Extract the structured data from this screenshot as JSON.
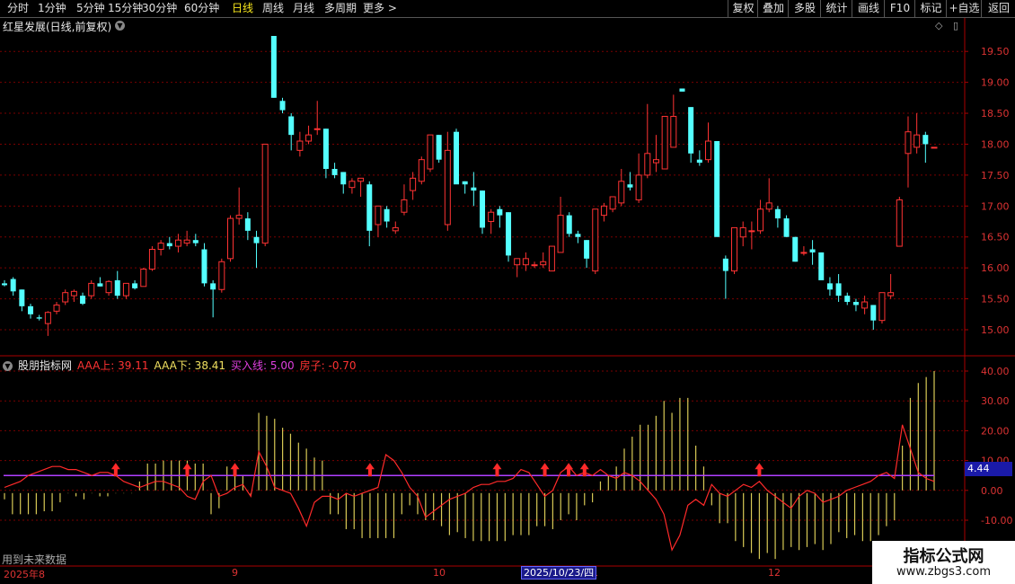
{
  "toolbar": {
    "periods": [
      "分时",
      "1分钟",
      "5分钟",
      "15分钟",
      "30分钟",
      "60分钟",
      "日线",
      "周线",
      "月线",
      "多周期",
      "更多 >"
    ],
    "active": "日线",
    "right_buttons": [
      "复权",
      "叠加",
      "多股",
      "统计",
      "画线",
      "F10",
      "标记",
      "+自选",
      "返回"
    ]
  },
  "stock": {
    "title": "红星发展(日线,前复权)"
  },
  "indicator": {
    "name": "股朋指标网",
    "lines": [
      {
        "label": "AAA上: 39.11",
        "color": "#ff3333"
      },
      {
        "label": "AAA下: 38.41",
        "color": "#f0e060"
      },
      {
        "label": "买入线: 5.00",
        "color": "#e040e0"
      },
      {
        "label": "房子: -0.70",
        "color": "#ff3333"
      }
    ],
    "value_badge": "4.44",
    "future_note": "用到未来数据"
  },
  "price_axis": [
    "19.50",
    "19.00",
    "18.50",
    "18.00",
    "17.50",
    "17.00",
    "16.50",
    "16.00",
    "15.50",
    "15.00"
  ],
  "ind_axis": [
    "40.00",
    "30.00",
    "20.00",
    "10.00",
    "0.00",
    "-10.00"
  ],
  "date_axis": {
    "labels": [
      {
        "text": "2025年8"
      },
      {
        "text": "9"
      },
      {
        "text": "10"
      },
      {
        "text": "1"
      },
      {
        "text": "12"
      }
    ],
    "cursor": "2025/10/23/四"
  },
  "watermark": {
    "line1": "指标公式网",
    "line2": "www.zbgs3.com"
  },
  "colors": {
    "up": "#ff3333",
    "down": "#54ffff",
    "grid": "#7a0000",
    "buyline": "#b040ff"
  },
  "chart_data": {
    "type": "candlestick",
    "price_ylim": [
      14.8,
      19.9
    ],
    "ind_ylim": [
      -15,
      42
    ],
    "candles": [
      [
        15.75,
        15.8,
        15.7,
        15.72
      ],
      [
        15.82,
        15.85,
        15.55,
        15.62
      ],
      [
        15.65,
        15.65,
        15.3,
        15.38
      ],
      [
        15.38,
        15.42,
        15.18,
        15.25
      ],
      [
        15.2,
        15.24,
        15.15,
        15.18
      ],
      [
        15.1,
        15.3,
        14.9,
        15.28
      ],
      [
        15.3,
        15.45,
        15.25,
        15.4
      ],
      [
        15.45,
        15.65,
        15.4,
        15.6
      ],
      [
        15.55,
        15.65,
        15.45,
        15.62
      ],
      [
        15.55,
        15.6,
        15.4,
        15.42
      ],
      [
        15.55,
        15.8,
        15.5,
        15.75
      ],
      [
        15.75,
        15.85,
        15.7,
        15.7
      ],
      [
        15.6,
        15.8,
        15.55,
        15.78
      ],
      [
        15.8,
        15.95,
        15.5,
        15.55
      ],
      [
        15.55,
        15.75,
        15.5,
        15.75
      ],
      [
        15.75,
        15.8,
        15.65,
        15.67
      ],
      [
        15.7,
        16.0,
        15.7,
        15.98
      ],
      [
        15.98,
        16.35,
        15.95,
        16.3
      ],
      [
        16.3,
        16.45,
        16.2,
        16.4
      ],
      [
        16.4,
        16.5,
        16.3,
        16.35
      ],
      [
        16.35,
        16.55,
        16.25,
        16.45
      ],
      [
        16.4,
        16.6,
        16.35,
        16.45
      ],
      [
        16.45,
        16.55,
        16.35,
        16.4
      ],
      [
        16.3,
        16.4,
        15.7,
        15.75
      ],
      [
        15.75,
        15.8,
        15.2,
        15.65
      ],
      [
        15.65,
        16.15,
        15.6,
        16.1
      ],
      [
        16.15,
        16.85,
        16.1,
        16.8
      ],
      [
        16.8,
        17.3,
        16.7,
        16.85
      ],
      [
        16.8,
        16.9,
        16.45,
        16.6
      ],
      [
        16.5,
        16.6,
        16.0,
        16.4
      ],
      [
        16.4,
        18.0,
        16.35,
        18.0
      ],
      [
        19.75,
        19.75,
        18.75,
        18.75
      ],
      [
        18.7,
        18.75,
        18.5,
        18.55
      ],
      [
        18.45,
        18.5,
        17.9,
        18.15
      ],
      [
        17.9,
        18.2,
        17.8,
        18.05
      ],
      [
        18.05,
        18.3,
        18.0,
        18.15
      ],
      [
        18.25,
        18.7,
        18.15,
        18.25
      ],
      [
        18.25,
        18.25,
        17.45,
        17.6
      ],
      [
        17.6,
        17.7,
        17.45,
        17.5
      ],
      [
        17.55,
        17.55,
        17.2,
        17.35
      ],
      [
        17.3,
        17.45,
        17.2,
        17.4
      ],
      [
        17.4,
        17.4,
        17.15,
        17.45
      ],
      [
        17.35,
        17.4,
        16.35,
        16.6
      ],
      [
        16.7,
        17.0,
        16.5,
        17.0
      ],
      [
        16.95,
        17.0,
        16.65,
        16.75
      ],
      [
        16.6,
        16.75,
        16.55,
        16.65
      ],
      [
        16.9,
        17.35,
        16.85,
        17.1
      ],
      [
        17.25,
        17.55,
        17.1,
        17.45
      ],
      [
        17.4,
        17.8,
        17.35,
        17.75
      ],
      [
        17.6,
        18.15,
        17.55,
        18.15
      ],
      [
        18.15,
        18.15,
        17.7,
        17.75
      ],
      [
        16.7,
        18.2,
        16.6,
        17.9
      ],
      [
        18.2,
        18.25,
        17.45,
        17.35
      ],
      [
        17.4,
        17.4,
        17.2,
        17.35
      ],
      [
        17.3,
        17.55,
        17.0,
        17.25
      ],
      [
        17.25,
        17.25,
        16.55,
        16.65
      ],
      [
        16.75,
        16.95,
        16.55,
        16.9
      ],
      [
        16.95,
        17.0,
        16.65,
        16.85
      ],
      [
        16.9,
        16.9,
        16.1,
        16.2
      ],
      [
        16.05,
        16.15,
        15.85,
        16.15
      ],
      [
        16.05,
        16.25,
        15.95,
        16.15
      ],
      [
        16.05,
        16.1,
        16.0,
        16.05
      ],
      [
        16.05,
        16.25,
        16.0,
        16.1
      ],
      [
        15.95,
        16.35,
        15.95,
        16.35
      ],
      [
        16.25,
        17.15,
        16.25,
        16.85
      ],
      [
        16.85,
        16.9,
        16.5,
        16.55
      ],
      [
        16.55,
        16.6,
        16.4,
        16.5
      ],
      [
        16.45,
        16.45,
        16.0,
        16.15
      ],
      [
        15.95,
        16.95,
        15.9,
        16.95
      ],
      [
        16.85,
        17.05,
        16.75,
        17.0
      ],
      [
        16.95,
        17.15,
        16.9,
        17.15
      ],
      [
        17.05,
        17.6,
        17.0,
        17.4
      ],
      [
        17.35,
        17.55,
        17.25,
        17.3
      ],
      [
        17.1,
        17.85,
        17.05,
        17.5
      ],
      [
        17.5,
        18.65,
        17.45,
        17.85
      ],
      [
        17.7,
        18.15,
        17.55,
        17.75
      ],
      [
        17.6,
        18.35,
        17.6,
        18.45
      ],
      [
        17.95,
        18.8,
        17.95,
        18.45
      ],
      [
        18.9,
        18.9,
        18.85,
        18.85
      ],
      [
        18.6,
        18.6,
        17.7,
        17.85
      ],
      [
        17.75,
        17.9,
        17.65,
        17.7
      ],
      [
        17.75,
        18.35,
        17.7,
        18.05
      ],
      [
        18.05,
        18.05,
        16.5,
        16.5
      ],
      [
        16.15,
        16.2,
        15.5,
        15.95
      ],
      [
        15.95,
        16.5,
        15.9,
        16.65
      ],
      [
        16.5,
        16.75,
        16.35,
        16.65
      ],
      [
        16.6,
        16.75,
        16.3,
        16.6
      ],
      [
        16.6,
        17.1,
        16.55,
        16.95
      ],
      [
        16.95,
        17.45,
        16.9,
        17.05
      ],
      [
        16.95,
        17.0,
        16.65,
        16.8
      ],
      [
        16.8,
        16.85,
        16.5,
        16.5
      ],
      [
        16.5,
        16.5,
        16.1,
        16.1
      ],
      [
        16.25,
        16.35,
        16.2,
        16.25
      ],
      [
        16.3,
        16.45,
        16.05,
        16.25
      ],
      [
        16.25,
        16.25,
        15.9,
        15.8
      ],
      [
        15.75,
        15.85,
        15.55,
        15.65
      ],
      [
        15.75,
        15.9,
        15.45,
        15.55
      ],
      [
        15.55,
        15.6,
        15.4,
        15.45
      ],
      [
        15.45,
        15.5,
        15.3,
        15.4
      ],
      [
        15.35,
        15.55,
        15.25,
        15.45
      ],
      [
        15.4,
        15.4,
        15.0,
        15.15
      ],
      [
        15.15,
        15.6,
        15.1,
        15.6
      ],
      [
        15.55,
        15.9,
        15.5,
        15.6
      ],
      [
        16.35,
        17.15,
        16.35,
        17.1
      ],
      [
        17.85,
        18.45,
        17.3,
        18.2
      ],
      [
        17.95,
        18.5,
        17.85,
        18.15
      ],
      [
        18.15,
        18.2,
        17.7,
        18.0
      ],
      [
        17.95,
        17.95,
        17.95,
        17.95
      ]
    ],
    "bars": [
      -3,
      -8,
      -8,
      -8,
      -8,
      -7,
      -7,
      -4,
      -1,
      -2,
      -3,
      -1,
      -2,
      -2,
      -1,
      -1,
      -1,
      3,
      9,
      9,
      10,
      10,
      10,
      10,
      9,
      9,
      -8,
      -6,
      8,
      8,
      5,
      -2,
      26,
      25,
      24,
      21,
      19,
      16,
      14,
      11,
      10,
      -8,
      -8,
      -13,
      -13,
      -16,
      -16,
      -16,
      -16,
      -16,
      -8,
      -5,
      -8,
      -10,
      -10,
      -12,
      -15,
      -14,
      -16,
      -17,
      -17,
      -17,
      -17,
      -17,
      -15,
      -15,
      -15,
      -12,
      -12,
      -13,
      -10,
      -8,
      -10,
      -5,
      -4,
      3,
      5,
      8,
      14,
      18,
      22,
      22,
      25,
      30,
      26,
      31,
      31,
      15,
      8,
      -5,
      -11,
      -11,
      -17,
      -19,
      -21,
      -23,
      -21,
      -23,
      -20,
      -19,
      -20,
      -19,
      -18,
      -20,
      -18,
      -14,
      -16,
      -15,
      -17,
      -17,
      -15,
      -12,
      -10,
      15,
      31,
      36,
      38,
      40
    ],
    "red_line": [
      1,
      2,
      3,
      5,
      6,
      7,
      8,
      8,
      7,
      7,
      6,
      5,
      6,
      6,
      5,
      3,
      2,
      1,
      2,
      3,
      3,
      2,
      1,
      -2,
      -3,
      3,
      5,
      -2,
      -1,
      1,
      2,
      -2,
      13,
      8,
      1,
      0,
      -1,
      -6,
      -12,
      -4,
      -2,
      -2,
      -3,
      -1,
      -2,
      -1,
      0,
      1,
      12,
      10,
      6,
      1,
      -2,
      -9,
      -7,
      -5,
      -3,
      -2,
      -1,
      1,
      2,
      2,
      3,
      3,
      4,
      7,
      6,
      2,
      -2,
      0,
      6,
      8,
      5,
      6,
      5,
      7,
      5,
      4,
      6,
      5,
      3,
      0,
      -3,
      -8,
      -20,
      -15,
      -5,
      -3,
      -5,
      2,
      -1,
      -2,
      0,
      2,
      1,
      3,
      0,
      -2,
      -4,
      -6,
      -2,
      0,
      -1,
      -4,
      -3,
      -2,
      0,
      1,
      2,
      3,
      5,
      6,
      4,
      22,
      14,
      6,
      4,
      3
    ],
    "buy_line": 5.0,
    "arrows_idx": [
      14,
      23,
      29,
      46,
      62,
      68,
      71,
      73,
      95
    ]
  }
}
